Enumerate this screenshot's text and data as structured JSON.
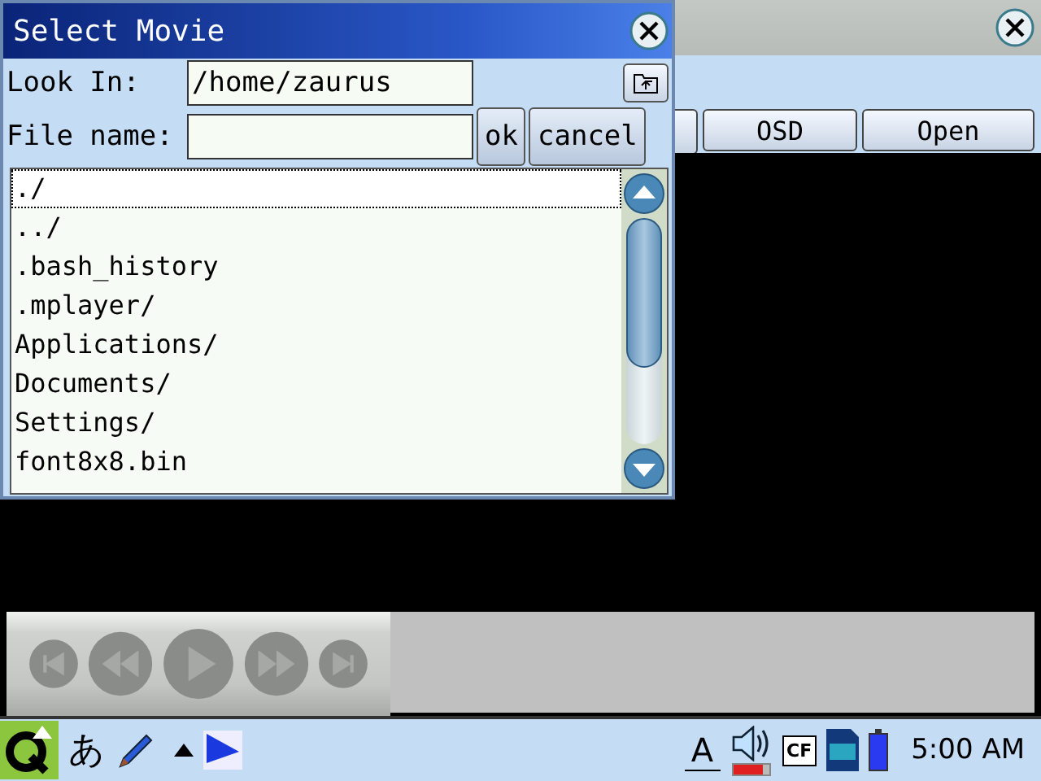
{
  "dialog": {
    "title": "Select Movie",
    "look_in": {
      "label": "Look In:",
      "value": "/home/zaurus"
    },
    "file_name": {
      "label": "File name:"
    },
    "buttons": [
      {
        "label": "ok"
      },
      {
        "label": "cancel"
      }
    ],
    "files": [
      {
        "name": "./",
        "selected": true
      },
      {
        "name": "../",
        "selected": false
      },
      {
        "name": ".bash_history",
        "selected": false
      },
      {
        "name": ".mplayer/",
        "selected": false
      },
      {
        "name": "Applications/",
        "selected": false
      },
      {
        "name": "Documents/",
        "selected": false
      },
      {
        "name": "Settings/",
        "selected": false
      },
      {
        "name": "font8x8.bin",
        "selected": false
      }
    ]
  },
  "player": {
    "toolbar_buttons": [
      "OSD",
      "Open"
    ]
  },
  "taskbar": {
    "input_method": "あ",
    "keyboard_label": "A",
    "volume": {
      "level": 0.85
    },
    "card_label": "CF",
    "clock": "5:00 AM"
  }
}
